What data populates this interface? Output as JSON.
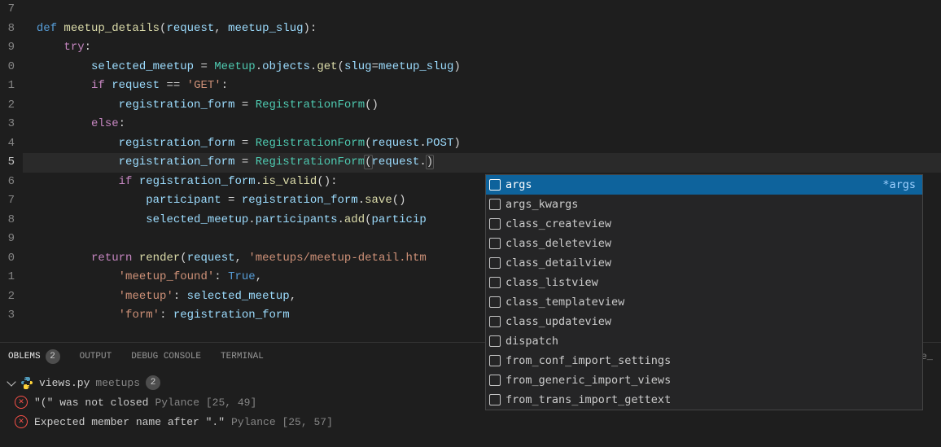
{
  "gutter": [
    "7",
    "8",
    "9",
    "0",
    "1",
    "2",
    "3",
    "4",
    "5",
    "6",
    "7",
    "8",
    "9",
    "0",
    "1",
    "2",
    "3"
  ],
  "current_line_index": 8,
  "code_tokens": [
    [],
    [
      {
        "t": "def ",
        "c": "kw"
      },
      {
        "t": "meetup_details",
        "c": "fn"
      },
      {
        "t": "(",
        "c": "punct"
      },
      {
        "t": "request",
        "c": "var"
      },
      {
        "t": ", ",
        "c": "punct"
      },
      {
        "t": "meetup_slug",
        "c": "var"
      },
      {
        "t": "):",
        "c": "punct"
      }
    ],
    [
      {
        "t": "    ",
        "c": ""
      },
      {
        "t": "try",
        "c": "kw2"
      },
      {
        "t": ":",
        "c": "punct"
      }
    ],
    [
      {
        "t": "        ",
        "c": ""
      },
      {
        "t": "selected_meetup",
        "c": "var"
      },
      {
        "t": " = ",
        "c": "punct"
      },
      {
        "t": "Meetup",
        "c": "cls"
      },
      {
        "t": ".",
        "c": "punct"
      },
      {
        "t": "objects",
        "c": "var"
      },
      {
        "t": ".",
        "c": "punct"
      },
      {
        "t": "get",
        "c": "fn"
      },
      {
        "t": "(",
        "c": "punct"
      },
      {
        "t": "slug",
        "c": "var"
      },
      {
        "t": "=",
        "c": "punct"
      },
      {
        "t": "meetup_slug",
        "c": "var"
      },
      {
        "t": ")",
        "c": "punct"
      }
    ],
    [
      {
        "t": "        ",
        "c": ""
      },
      {
        "t": "if",
        "c": "kw2"
      },
      {
        "t": " ",
        "c": ""
      },
      {
        "t": "request",
        "c": "var"
      },
      {
        "t": " == ",
        "c": "punct"
      },
      {
        "t": "'GET'",
        "c": "str"
      },
      {
        "t": ":",
        "c": "punct"
      }
    ],
    [
      {
        "t": "            ",
        "c": ""
      },
      {
        "t": "registration_form",
        "c": "var"
      },
      {
        "t": " = ",
        "c": "punct"
      },
      {
        "t": "RegistrationForm",
        "c": "cls"
      },
      {
        "t": "()",
        "c": "punct"
      }
    ],
    [
      {
        "t": "        ",
        "c": ""
      },
      {
        "t": "else",
        "c": "kw2"
      },
      {
        "t": ":",
        "c": "punct"
      }
    ],
    [
      {
        "t": "            ",
        "c": ""
      },
      {
        "t": "registration_form",
        "c": "var"
      },
      {
        "t": " = ",
        "c": "punct"
      },
      {
        "t": "RegistrationForm",
        "c": "cls"
      },
      {
        "t": "(",
        "c": "punct"
      },
      {
        "t": "request",
        "c": "var"
      },
      {
        "t": ".",
        "c": "punct"
      },
      {
        "t": "POST",
        "c": "var"
      },
      {
        "t": ")",
        "c": "punct"
      }
    ],
    [
      {
        "t": "            ",
        "c": ""
      },
      {
        "t": "registration_form",
        "c": "var"
      },
      {
        "t": " = ",
        "c": "punct"
      },
      {
        "t": "RegistrationForm",
        "c": "cls"
      },
      {
        "t": "(",
        "c": "punct paren-match"
      },
      {
        "t": "request",
        "c": "var"
      },
      {
        "t": ".",
        "c": "punct"
      },
      {
        "t": ")",
        "c": "punct paren-match"
      }
    ],
    [
      {
        "t": "            ",
        "c": ""
      },
      {
        "t": "if",
        "c": "kw2"
      },
      {
        "t": " ",
        "c": ""
      },
      {
        "t": "registration_form",
        "c": "var"
      },
      {
        "t": ".",
        "c": "punct"
      },
      {
        "t": "is_valid",
        "c": "fn"
      },
      {
        "t": "():",
        "c": "punct"
      }
    ],
    [
      {
        "t": "                ",
        "c": ""
      },
      {
        "t": "participant",
        "c": "var"
      },
      {
        "t": " = ",
        "c": "punct"
      },
      {
        "t": "registration_form",
        "c": "var"
      },
      {
        "t": ".",
        "c": "punct"
      },
      {
        "t": "save",
        "c": "fn"
      },
      {
        "t": "()",
        "c": "punct"
      }
    ],
    [
      {
        "t": "                ",
        "c": ""
      },
      {
        "t": "selected_meetup",
        "c": "var"
      },
      {
        "t": ".",
        "c": "punct"
      },
      {
        "t": "participants",
        "c": "var"
      },
      {
        "t": ".",
        "c": "punct"
      },
      {
        "t": "add",
        "c": "fn"
      },
      {
        "t": "(",
        "c": "punct"
      },
      {
        "t": "particip",
        "c": "var"
      }
    ],
    [],
    [
      {
        "t": "        ",
        "c": ""
      },
      {
        "t": "return",
        "c": "kw2"
      },
      {
        "t": " ",
        "c": ""
      },
      {
        "t": "render",
        "c": "fn"
      },
      {
        "t": "(",
        "c": "punct"
      },
      {
        "t": "request",
        "c": "var"
      },
      {
        "t": ", ",
        "c": "punct"
      },
      {
        "t": "'meetups/meetup-detail.htm",
        "c": "str"
      }
    ],
    [
      {
        "t": "            ",
        "c": ""
      },
      {
        "t": "'meetup_found'",
        "c": "str"
      },
      {
        "t": ": ",
        "c": "punct"
      },
      {
        "t": "True",
        "c": "const"
      },
      {
        "t": ",",
        "c": "punct"
      }
    ],
    [
      {
        "t": "            ",
        "c": ""
      },
      {
        "t": "'meetup'",
        "c": "str"
      },
      {
        "t": ": ",
        "c": "punct"
      },
      {
        "t": "selected_meetup",
        "c": "var"
      },
      {
        "t": ",",
        "c": "punct"
      }
    ],
    [
      {
        "t": "            ",
        "c": ""
      },
      {
        "t": "'form'",
        "c": "str"
      },
      {
        "t": ": ",
        "c": "punct"
      },
      {
        "t": "registration_form",
        "c": "var"
      }
    ]
  ],
  "suggestions": [
    {
      "label": "args",
      "hint": "*args",
      "selected": true
    },
    {
      "label": "args_kwargs"
    },
    {
      "label": "class_createview"
    },
    {
      "label": "class_deleteview"
    },
    {
      "label": "class_detailview"
    },
    {
      "label": "class_listview"
    },
    {
      "label": "class_templateview"
    },
    {
      "label": "class_updateview"
    },
    {
      "label": "dispatch"
    },
    {
      "label": "from_conf_import_settings"
    },
    {
      "label": "from_generic_import_views"
    },
    {
      "label": "from_trans_import_gettext"
    }
  ],
  "panel": {
    "tabs": {
      "problems": {
        "label": "OBLEMS",
        "badge": "2",
        "active": true
      },
      "output": {
        "label": "OUTPUT"
      },
      "debug": {
        "label": "DEBUG CONSOLE"
      },
      "terminal": {
        "label": "TERMINAL"
      }
    },
    "right_hint": "ode_",
    "file": {
      "name": "views.py",
      "folder": "meetups",
      "badge": "2"
    },
    "problems": [
      {
        "msg": "\"(\" was not closed",
        "source": "Pylance",
        "loc": "[25, 49]"
      },
      {
        "msg": "Expected member name after \".\"",
        "source": "Pylance",
        "loc": "[25, 57]"
      }
    ]
  }
}
